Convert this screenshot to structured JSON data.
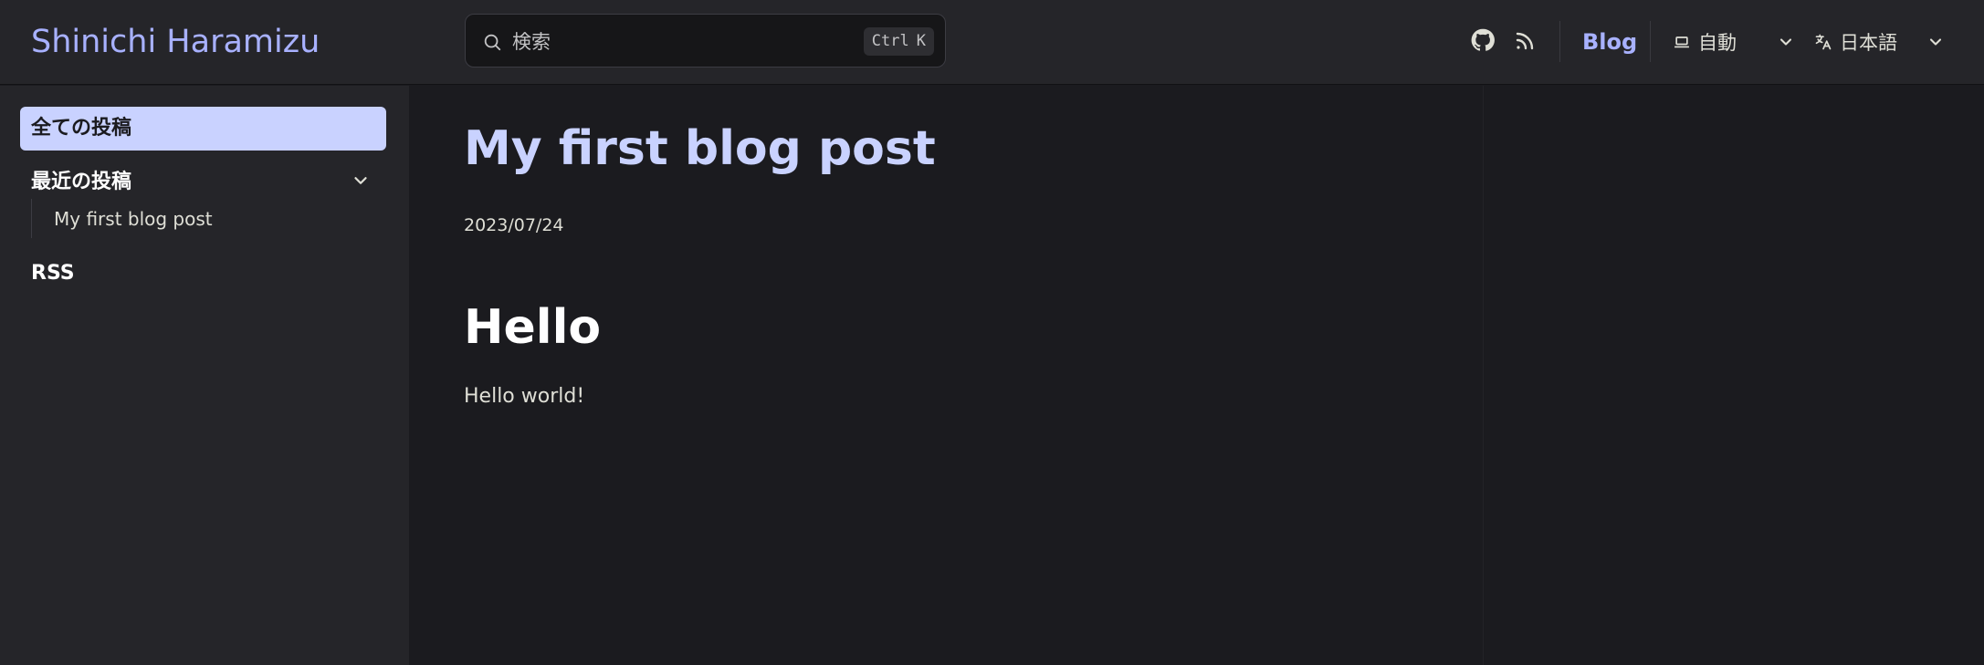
{
  "header": {
    "site_title": "Shinichi Haramizu",
    "search": {
      "placeholder": "検索",
      "shortcut_key1": "Ctrl",
      "shortcut_key2": "K"
    },
    "icons": [
      "github-icon",
      "rss-icon"
    ],
    "nav_link": "Blog",
    "appearance_label": "自動",
    "language_label": "日本語"
  },
  "sidebar": {
    "active_item": "全ての投稿",
    "group_title": "最近の投稿",
    "group_items": [
      "My first blog post"
    ],
    "rss": "RSS"
  },
  "article": {
    "title": "My first blog post",
    "date": "2023/07/24",
    "heading": "Hello",
    "paragraph": "Hello world!"
  },
  "colors": {
    "background": "#1b1b1f",
    "panel": "#252529",
    "accent": "#a8b1ff",
    "active_bg": "#c9d2ff"
  }
}
